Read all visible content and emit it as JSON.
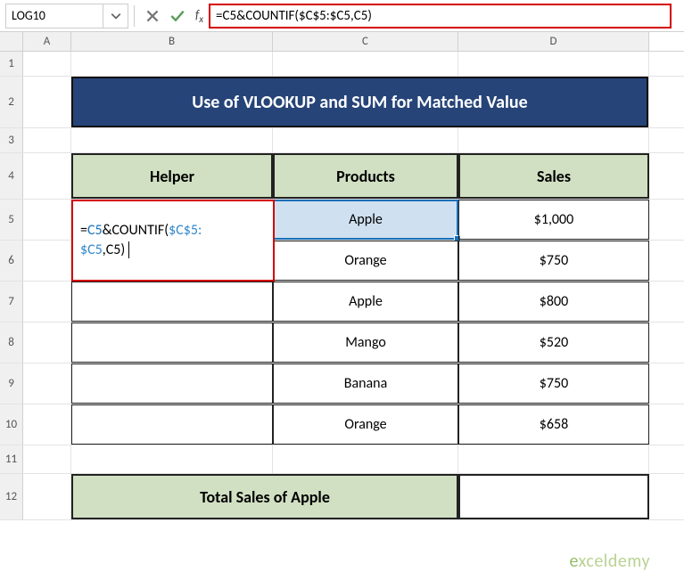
{
  "name_box": {
    "value": "LOG10"
  },
  "formula_bar": {
    "text": "=C5&COUNTIF($C$5:$C5,C5)"
  },
  "columns": {
    "A": "A",
    "B": "B",
    "C": "C",
    "D": "D"
  },
  "rows": [
    "1",
    "2",
    "3",
    "4",
    "5",
    "6",
    "7",
    "8",
    "9",
    "10",
    "11",
    "12"
  ],
  "title": "Use of VLOOKUP and SUM for Matched Value",
  "headers": {
    "helper": "Helper",
    "products": "Products",
    "sales": "Sales"
  },
  "cell_edit": {
    "line1": "=C5&COUNTIF($C$5:",
    "line2": "$C5,C5)",
    "c5": "C5",
    "abs": "$C$5:",
    "sc5": "$C5",
    "tail": ",C5)"
  },
  "chart_data": {
    "type": "table",
    "columns": [
      "Helper",
      "Products",
      "Sales"
    ],
    "rows": [
      {
        "helper": "=C5&COUNTIF($C$5:$C5,C5)",
        "product": "Apple",
        "sales": "$1,000"
      },
      {
        "helper": "",
        "product": "Orange",
        "sales": "$750"
      },
      {
        "helper": "",
        "product": "Apple",
        "sales": "$800"
      },
      {
        "helper": "",
        "product": "Mango",
        "sales": "$520"
      },
      {
        "helper": "",
        "product": "Banana",
        "sales": "$750"
      },
      {
        "helper": "",
        "product": "Orange",
        "sales": "$658"
      }
    ]
  },
  "total_label": "Total Sales of Apple",
  "watermark": {
    "brand_e": "e",
    "brand_rest": "xceldemy"
  }
}
